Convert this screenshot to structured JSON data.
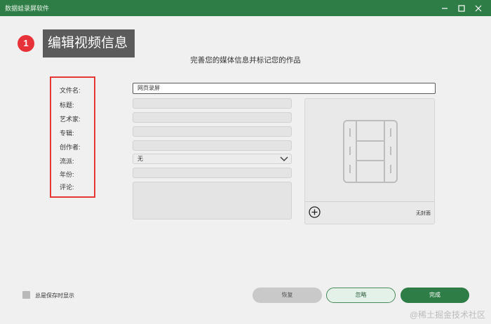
{
  "window": {
    "title": "数据蛙录屏软件"
  },
  "callout": {
    "step_number": "1",
    "text": "编辑视频信息"
  },
  "dialog": {
    "subtitle": "完善您的媒体信息并标记您的作品"
  },
  "fields": {
    "filename_label": "文件名:",
    "filename_value": "网页录屏",
    "title_label": "标题:",
    "artist_label": "艺术家:",
    "album_label": "专辑:",
    "creator_label": "创作者:",
    "genre_label": "流派:",
    "genre_value": "无",
    "year_label": "年份:",
    "comment_label": "评论:"
  },
  "cover": {
    "no_cover_label": "无封面"
  },
  "footer": {
    "always_show_label": "总是保存时显示",
    "always_show_checked": false,
    "reset_label": "恢复",
    "ignore_label": "忽略",
    "done_label": "完成"
  },
  "watermark": "@稀土掘金技术社区",
  "colors": {
    "titlebar": "#2f7d46",
    "primary_button": "#2f7d46",
    "highlight_box": "#e53935",
    "badge": "#e8323a"
  },
  "icons": {
    "minimize": "minimize-icon",
    "maximize": "maximize-icon",
    "close": "close-icon",
    "dropdown": "chevron-down-icon",
    "add_cover": "plus-circle-icon",
    "cover_placeholder": "film-strip-icon"
  }
}
